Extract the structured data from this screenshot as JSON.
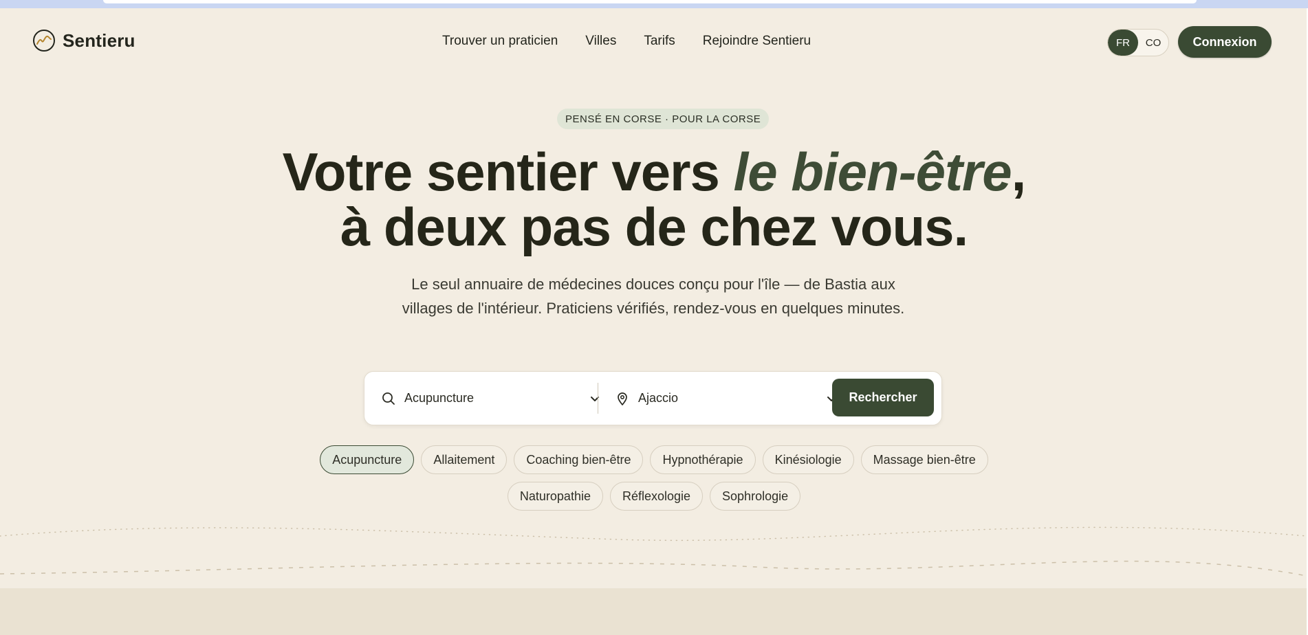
{
  "header": {
    "logo_text": "Sentieru",
    "nav": [
      "Trouver un praticien",
      "Villes",
      "Tarifs",
      "Rejoindre Sentieru"
    ],
    "lang": {
      "active": "FR",
      "inactive": "CO"
    },
    "connexion_label": "Connexion"
  },
  "hero": {
    "badge": "PENSÉ EN CORSE · POUR LA CORSE",
    "title_part1": "Votre sentier vers ",
    "title_accent": "le bien-être",
    "title_part2": ",",
    "title_line2": "à deux pas de chez vous.",
    "subtitle": "Le seul annuaire de médecines douces conçu pour l'île — de Bastia aux villages de l'intérieur. Praticiens vérifiés, rendez-vous en quelques minutes."
  },
  "search": {
    "specialty_value": "Acupuncture",
    "city_value": "Ajaccio",
    "button_label": "Rechercher",
    "icons": {
      "specialty": "search-icon",
      "city": "map-pin-icon",
      "dropdown": "chevron-down-icon"
    }
  },
  "chips": {
    "selected": "Acupuncture",
    "row1": [
      "Acupuncture",
      "Allaitement",
      "Coaching bien-être",
      "Hypnothérapie",
      "Kinésiologie",
      "Massage bien-être"
    ],
    "row2": [
      "Naturopathie",
      "Réflexologie",
      "Sophrologie"
    ]
  },
  "colors": {
    "background": "#f3ede2",
    "primary": "#3a4a33",
    "accent_text": "#3e4c36",
    "chip_selected": "#e2e8dc",
    "footer_band": "#eae2d2"
  }
}
